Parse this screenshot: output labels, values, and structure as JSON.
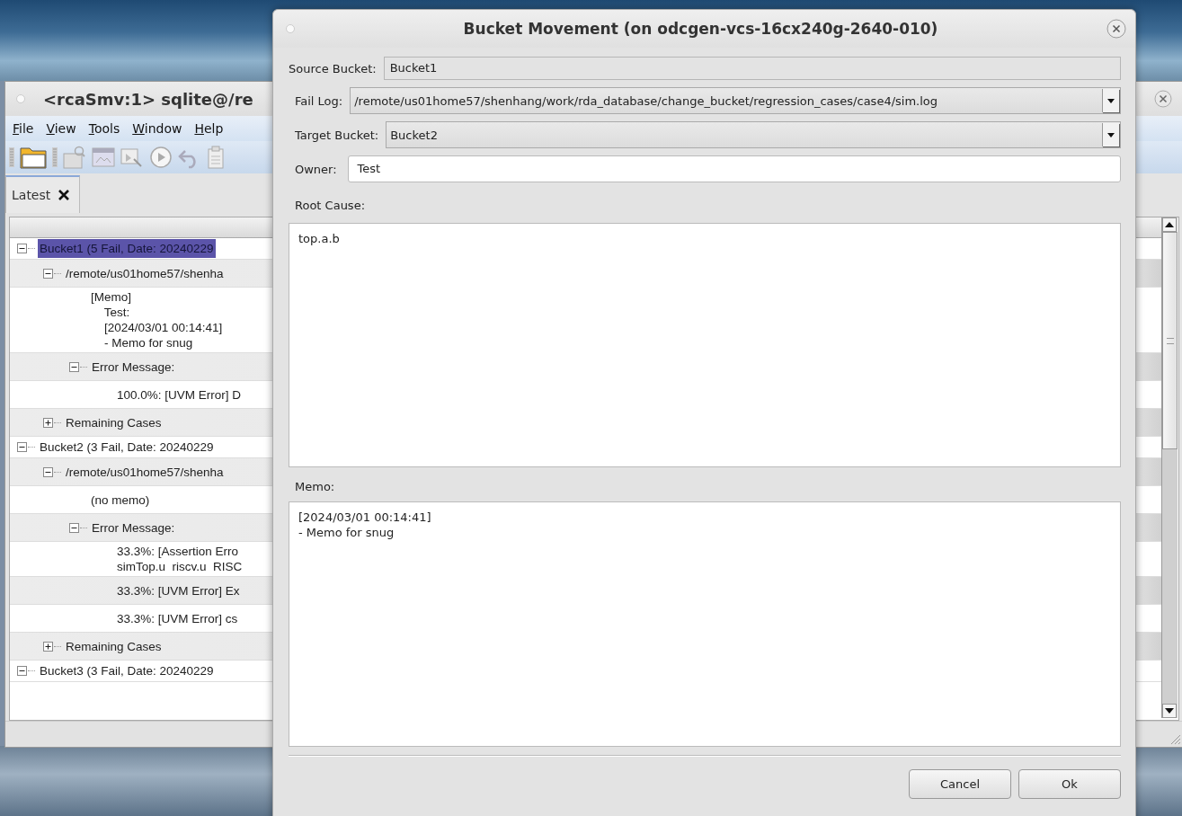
{
  "background_window": {
    "title": "<rcaSmv:1> sqlite@/re",
    "menu": [
      {
        "label": "File"
      },
      {
        "label": "View"
      },
      {
        "label": "Tools"
      },
      {
        "label": "Window"
      },
      {
        "label": "Help"
      }
    ],
    "tabs": [
      {
        "label": "Latest",
        "selected": true
      }
    ],
    "tree": [
      {
        "label": "Bucket1 (5 Fail, Date: 20240229",
        "expanded": true,
        "selected": true,
        "children": [
          {
            "label": "/remote/us01home57/shenha",
            "expanded": true,
            "selected": false,
            "children": [
              {
                "label": "[Memo]\n    Test:\n    [2024/03/01 00:14:41]\n    - Memo for snug",
                "selected": false
              },
              {
                "label": "Error Message:",
                "expanded": true,
                "selected": false,
                "children": [
                  {
                    "label": "100.0%: [UVM Error] D",
                    "selected": false
                  }
                ]
              }
            ]
          },
          {
            "label": "Remaining Cases",
            "expanded": false,
            "selected": false
          }
        ]
      },
      {
        "label": "Bucket2 (3 Fail, Date: 20240229",
        "expanded": true,
        "selected": false,
        "children": [
          {
            "label": "/remote/us01home57/shenha",
            "expanded": true,
            "selected": false,
            "children": [
              {
                "label": "(no memo)",
                "selected": false
              },
              {
                "label": "Error Message:",
                "expanded": true,
                "selected": false,
                "children": [
                  {
                    "label": "33.3%: [Assertion Erro\nsimTop.u  riscv.u  RISC",
                    "selected": false
                  },
                  {
                    "label": "33.3%: [UVM Error] Ex",
                    "selected": false
                  },
                  {
                    "label": "33.3%: [UVM Error] cs",
                    "selected": false
                  }
                ]
              }
            ]
          },
          {
            "label": "Remaining Cases",
            "expanded": false,
            "selected": false
          }
        ]
      },
      {
        "label": "Bucket3 (3 Fail, Date: 20240229",
        "expanded": true,
        "selected": false
      }
    ]
  },
  "dialog": {
    "title": "Bucket Movement (on odcgen-vcs-16cx240g-2640-010)",
    "source_bucket": {
      "label": "Source Bucket:",
      "value": "Bucket1"
    },
    "fail_log": {
      "label": "Fail Log:",
      "value": "/remote/us01home57/shenhang/work/rda_database/change_bucket/regression_cases/case4/sim.log"
    },
    "target_bucket": {
      "label": "Target Bucket:",
      "value": "Bucket2"
    },
    "owner": {
      "label": "Owner:",
      "value": "Test"
    },
    "root_cause": {
      "label": "Root Cause:",
      "value": "top.a.b"
    },
    "memo": {
      "label": "Memo:",
      "value": "[2024/03/01 00:14:41]\n- Memo for snug"
    },
    "buttons": [
      {
        "label": "Cancel"
      },
      {
        "label": "Ok"
      }
    ]
  }
}
